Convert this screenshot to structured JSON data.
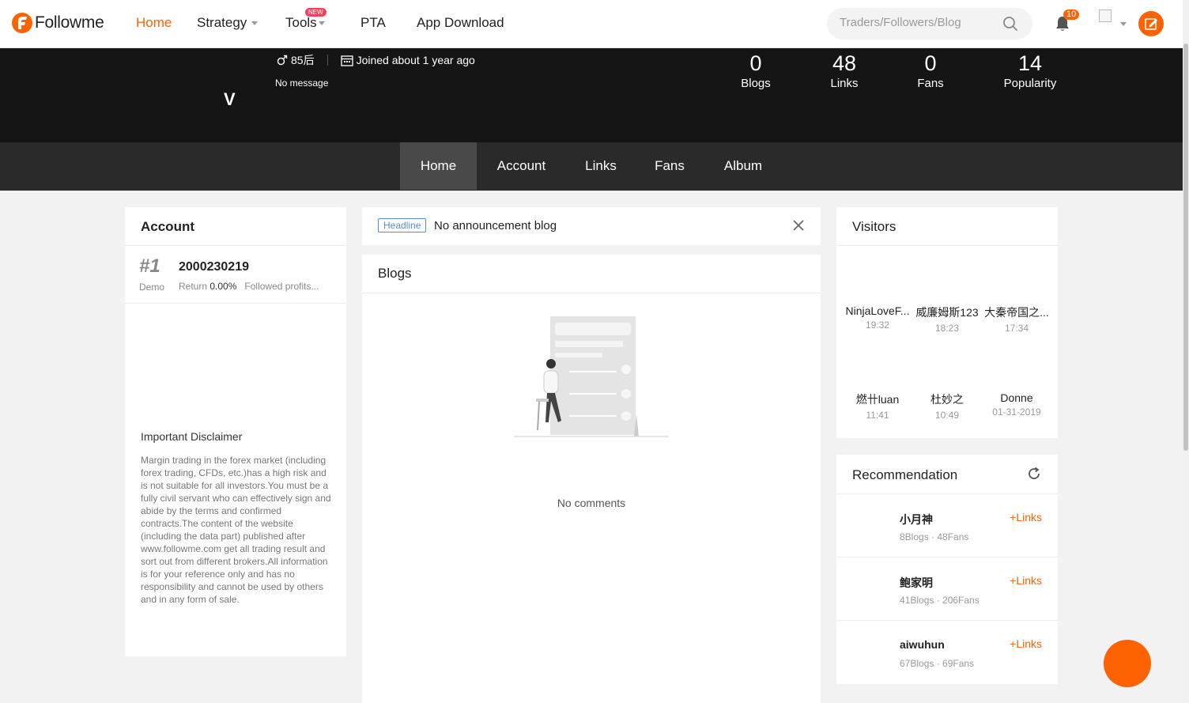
{
  "app": {
    "logo_text": "Followme",
    "brand_color": "#ff6200"
  },
  "nav": {
    "items": [
      "Home",
      "Strategy",
      "Tools",
      "PTA",
      "App Download"
    ],
    "active": "Home",
    "tools_badge": "NEW"
  },
  "search": {
    "placeholder": "Traders/Followers/Blog"
  },
  "notifications": {
    "count": "10"
  },
  "profile": {
    "initial": "V",
    "gender_age": "85后",
    "joined": "Joined about 1 year ago",
    "message": "No message",
    "stats": [
      {
        "value": "0",
        "label": "Blogs"
      },
      {
        "value": "48",
        "label": "Links"
      },
      {
        "value": "0",
        "label": "Fans"
      },
      {
        "value": "14",
        "label": "Popularity"
      }
    ]
  },
  "subnav": {
    "items": [
      "Home",
      "Account",
      "Links",
      "Fans",
      "Album"
    ],
    "active": "Home"
  },
  "account_panel": {
    "title": "Account",
    "rank": "#1",
    "account_type": "Demo",
    "account_number": "2000230219",
    "return_label": "Return",
    "return_value": "0.00%",
    "followed": "Followed profits...",
    "disclaimer_title": "Important Disclaimer",
    "disclaimer_text": "Margin trading in the forex market (including forex trading, CFDs, etc.)has a high risk and is not suitable for all investors.You must be a fully civil servant who can effectively sign and abide by the terms and confirmed contracts.The content of the website (including the data part) published after www.followme.com get all trading result and sort out from different brokers.All information is for your reference only and has no responsibility and cannot be used by others and in any form of sale."
  },
  "headline": {
    "tag": "Headline",
    "text": "No announcement blog"
  },
  "blogs": {
    "title": "Blogs",
    "empty": "No comments"
  },
  "visitors": {
    "title": "Visitors",
    "list": [
      {
        "name": "NinjaLoveF...",
        "time": "19:32"
      },
      {
        "name": "威廉姆斯123",
        "time": "18:23"
      },
      {
        "name": "大秦帝国之...",
        "time": "17:34"
      },
      {
        "name": "燃卄luan",
        "time": "11:41"
      },
      {
        "name": "杜妙之",
        "time": "10:49"
      },
      {
        "name": "Donne",
        "time": "01-31-2019"
      }
    ]
  },
  "recommendation": {
    "title": "Recommendation",
    "items": [
      {
        "name": "小月神",
        "meta": "8Blogs · 48Fans",
        "action": "Links"
      },
      {
        "name": "鲍家明",
        "meta": "41Blogs · 206Fans",
        "action": "Links"
      },
      {
        "name": "aiwuhun",
        "meta": "67Blogs · 69Fans",
        "action": "Links"
      }
    ]
  }
}
